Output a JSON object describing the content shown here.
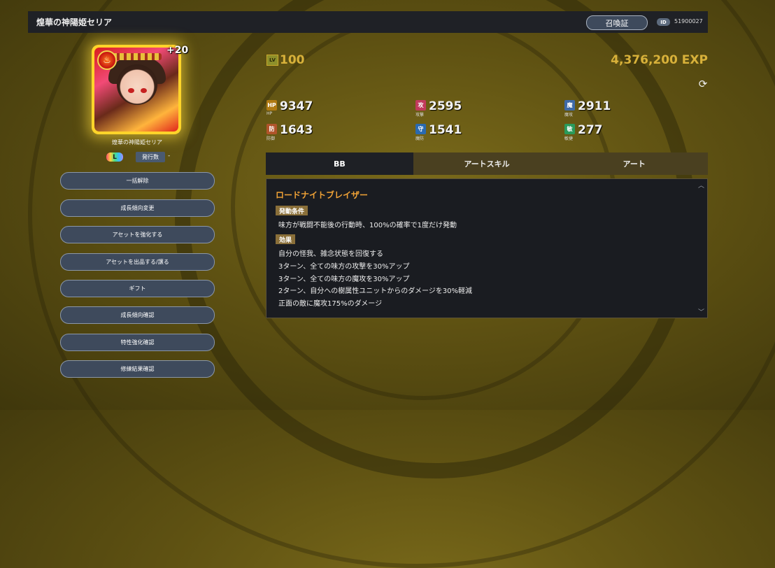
{
  "header": {
    "title": "煌華の神陽姫セリア",
    "summon_button": "召喚証",
    "id_label": "ID",
    "id_value": "51900027"
  },
  "unit": {
    "plus_value": "+20",
    "name": "煌華の神陽姫セリア",
    "rarity_label": "L",
    "issued_label": "発行数",
    "issued_value": "-",
    "level_label": "LV",
    "level": "100",
    "exp": "4,376,200 EXP"
  },
  "stats": [
    {
      "label": "HP",
      "icon": "HP",
      "value": "9347",
      "color": "#b07a12"
    },
    {
      "label": "攻撃",
      "icon": "攻",
      "value": "2595",
      "color": "#c23a5c"
    },
    {
      "label": "魔攻",
      "icon": "魔",
      "value": "2911",
      "color": "#3e6aa8"
    },
    {
      "label": "防御",
      "icon": "防",
      "value": "1643",
      "color": "#b0542a"
    },
    {
      "label": "魔防",
      "icon": "守",
      "value": "1541",
      "color": "#2a6ab0"
    },
    {
      "label": "敏捷",
      "icon": "敏",
      "value": "277",
      "color": "#2a9a5a"
    }
  ],
  "actions": [
    "一括解除",
    "成長傾向変更",
    "アセットを強化する",
    "アセットを出品する/譲る",
    "ギフト",
    "成長傾向確認",
    "特性強化確認",
    "修練結果確認"
  ],
  "tabs": [
    "BB",
    "アートスキル",
    "アート"
  ],
  "active_tab": "BB",
  "skill": {
    "name": "ロードナイトブレイザー",
    "condition_label": "発動条件",
    "condition": "味方が戦闘不能後の行動時、100%の確率で1度だけ発動",
    "effect_label": "効果",
    "effects": [
      "自分の怪我、雑念状態を回復する",
      "3ターン、全ての味方の攻撃を30%アップ",
      "3ターン、全ての味方の魔攻を30%アップ",
      "2ターン、自分への樹属性ユニットからのダメージを30%軽減",
      "正面の敵に魔攻175%のダメージ"
    ]
  },
  "icons": {
    "element": "fire-element-icon",
    "refresh": "refresh-icon",
    "scroll_up": "chevron-up-icon",
    "scroll_down": "chevron-down-icon"
  }
}
